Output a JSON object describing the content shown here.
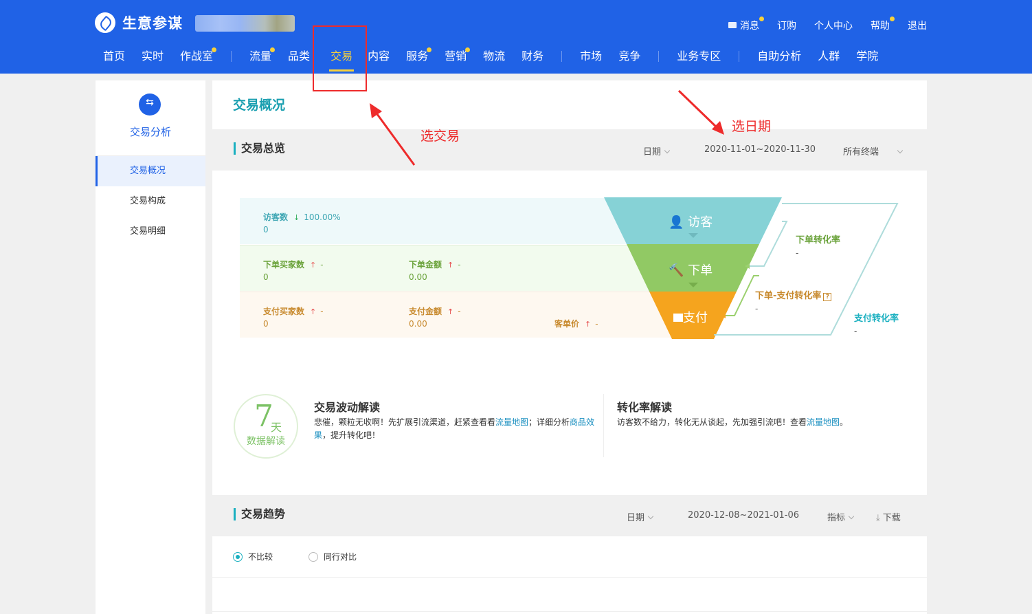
{
  "header": {
    "logo_text": "生意参谋",
    "top_links": {
      "messages": "消息",
      "subscribe": "订购",
      "personal_center": "个人中心",
      "help": "帮助",
      "logout": "退出"
    },
    "nav": {
      "home": "首页",
      "realtime": "实时",
      "war_room": "作战室",
      "traffic": "流量",
      "category": "品类",
      "trade": "交易",
      "content": "内容",
      "service": "服务",
      "marketing": "营销",
      "logistics": "物流",
      "finance": "财务",
      "market": "市场",
      "competition": "竞争",
      "business_zone": "业务专区",
      "self_analysis": "自助分析",
      "crowd": "人群",
      "academy": "学院"
    },
    "accent_color": "#2062e6",
    "badge_color": "#f7d13b"
  },
  "sidebar": {
    "icon": "exchange-icon",
    "title": "交易分析",
    "items": [
      {
        "label": "交易概况",
        "active": true
      },
      {
        "label": "交易构成",
        "active": false
      },
      {
        "label": "交易明细",
        "active": false
      }
    ]
  },
  "main": {
    "page_title": "交易概况",
    "overview": {
      "section_title": "交易总览",
      "date_label": "日期",
      "date_range": "2020-11-01~2020-11-30",
      "terminal": "所有终端",
      "visitors": {
        "label": "访客数",
        "change": "100.00%",
        "value": "0"
      },
      "order_buyers": {
        "label": "下单买家数",
        "change": "-",
        "value": "0"
      },
      "order_amount": {
        "label": "下单金额",
        "change": "-",
        "value": "0.00"
      },
      "pay_buyers": {
        "label": "支付买家数",
        "change": "-",
        "value": "0"
      },
      "pay_amount": {
        "label": "支付金额",
        "change": "-",
        "value": "0.00"
      },
      "unit_price": {
        "label": "客单价",
        "change": "-"
      },
      "funnel": {
        "visitor": "访客",
        "order": "下单",
        "pay": "支付",
        "colors": {
          "visitor": "#86d2d6",
          "order": "#91c964",
          "pay": "#f5a41e"
        }
      },
      "conversion": {
        "order_rate": {
          "label": "下单转化率",
          "value": "-"
        },
        "order_pay_rate": {
          "label": "下单-支付转化率",
          "value": "-"
        },
        "pay_rate": {
          "label": "支付转化率",
          "value": "-"
        }
      }
    },
    "interpretation": {
      "badge_num": "7",
      "badge_unit": "天",
      "badge_sub": "数据解读",
      "trade_title": "交易波动解读",
      "trade_text_1": "悲催，颗粒无收啊！先扩展引流渠道，赶紧查看看",
      "trade_link_1": "流量地图",
      "trade_text_2": "；详细分析",
      "trade_link_2": "商品效果",
      "trade_text_3": "，提升转化吧！",
      "conv_title": "转化率解读",
      "conv_text_1": "访客数不给力，转化无从谈起，先加强引流吧！查看",
      "conv_link": "流量地图",
      "conv_text_2": "。"
    },
    "trend": {
      "section_title": "交易趋势",
      "date_label": "日期",
      "date_range": "2020-12-08~2021-01-06",
      "metric_label": "指标",
      "download_label": "下载",
      "radio_no_compare": "不比较",
      "radio_peer_compare": "同行对比"
    }
  },
  "annotations": {
    "select_trade": "选交易",
    "select_date": "选日期",
    "color": "#ee2b2b"
  }
}
